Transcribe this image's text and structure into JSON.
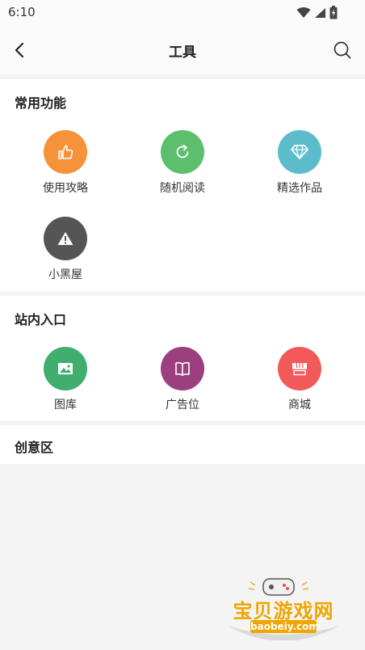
{
  "status_bar": {
    "time": "6:10"
  },
  "header": {
    "title": "工具"
  },
  "sections": {
    "common": {
      "title": "常用功能",
      "items": [
        {
          "label": "使用攻略",
          "color": "#f5923a",
          "icon": "thumbs-up-icon"
        },
        {
          "label": "随机阅读",
          "color": "#5cbf6d",
          "icon": "refresh-icon"
        },
        {
          "label": "精选作品",
          "color": "#5bbccb",
          "icon": "diamond-icon"
        },
        {
          "label": "小黑屋",
          "color": "#555555",
          "icon": "warning-icon"
        }
      ]
    },
    "entrance": {
      "title": "站内入口",
      "items": [
        {
          "label": "图库",
          "color": "#3fae6f",
          "icon": "image-icon"
        },
        {
          "label": "广告位",
          "color": "#9b3f7e",
          "icon": "book-icon"
        },
        {
          "label": "商城",
          "color": "#f25a5a",
          "icon": "shop-icon"
        }
      ]
    },
    "creative": {
      "title": "创意区"
    }
  },
  "watermark": {
    "brand": "宝贝游戏网",
    "domain": "baobeiy.com"
  }
}
